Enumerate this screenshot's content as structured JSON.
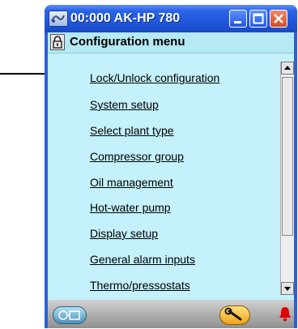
{
  "window": {
    "title": "00:000 AK-HP 780"
  },
  "menu": {
    "title": "Configuration menu",
    "items": [
      "Lock/Unlock configuration",
      "System setup",
      "Select plant type",
      "Compressor group",
      "Oil management",
      "Hot-water pump",
      "Display setup",
      "General alarm inputs",
      "Thermo/pressostats"
    ]
  },
  "icons": {
    "title": "device-icon",
    "lock": "lock-icon",
    "status_left": "network-icon",
    "status_middle": "wrench-icon",
    "status_right": "alarm-bell-icon"
  },
  "colors": {
    "titlebar": "#2160dc",
    "content_background": "#c4f1fb",
    "close_button": "#d9552c",
    "alarm": "#e00000"
  }
}
